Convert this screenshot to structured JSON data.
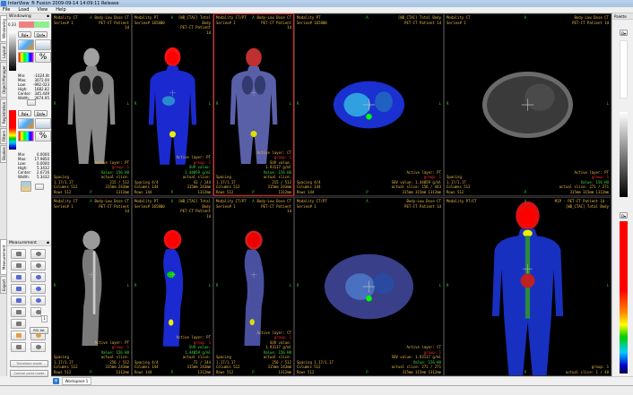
{
  "app": {
    "title": "InterView ® Fusion 2009-09-14 14:09:11 Release"
  },
  "menu": [
    "File",
    "Load",
    "View",
    "Help"
  ],
  "left_tabs": {
    "top": [
      "Windowing",
      "Layout",
      "Object Manager",
      "Registration",
      "Filters",
      "Studies"
    ],
    "bottom": [
      "Measurement",
      "Export"
    ]
  },
  "windowing": {
    "title": "Windowing",
    "opacity": "0.33",
    "layer1": {
      "pal": "Pal",
      "def": "Def",
      "min": "-1024.0t",
      "max": "3072.00",
      "low": "-992.023",
      "high": "1682.82",
      "center": "345.449",
      "width": "2674.95"
    },
    "layer2": {
      "pal": "Pal",
      "def": "Def",
      "min": "0.0000",
      "max": "17.9850",
      "low": "0.0000",
      "high": "5.3432",
      "center": "2.6716",
      "width": "5.3432"
    },
    "labels": {
      "min": "Min:",
      "max": "Max:",
      "low": "Low:",
      "high": "High:",
      "center": "Center:",
      "width": "Width:"
    }
  },
  "measurement": {
    "title": "Measurement",
    "spin_value": "1",
    "roi_button": "ROI list",
    "transform_button": "Transform mode",
    "control_point_button": "Control point mode"
  },
  "palette": {
    "title": "Palette",
    "dropdown": "D"
  },
  "taskbar": {
    "workspace_tab": "Workspace 1"
  },
  "colors": {
    "accent_selected": "#e22222",
    "overlay_text": "#e8b84a",
    "overlay_red": "#ff3030",
    "overlay_green": "#40e040"
  },
  "viewports": [
    {
      "img": "ct_cor",
      "tl": [
        "Modality CT",
        "Series# 1"
      ],
      "tr": [
        "Body-Low Dose CT",
        "PET-CT Patient",
        "1d"
      ],
      "bl": [
        "",
        "",
        "Spacing",
        "1.17/1.17",
        "Columns 512",
        "Rows 512"
      ],
      "br": [
        "Active layer: PT",
        "<r>group: 1",
        "<g>Value: 156 HU",
        "actual slice:",
        "215 / 512",
        "315mm 243mm",
        "1312mm"
      ]
    },
    {
      "img": "pet_cor",
      "tl": [
        "Modality PT",
        "Series# 165800"
      ],
      "tr": [
        "[WB_CTAC] Total",
        "Body",
        "PET-CT Patient",
        "1d"
      ],
      "bl": [
        "",
        "",
        "",
        "Spacing 4/4",
        "Columns 144",
        "Rows 144"
      ],
      "br": [
        "Active layer: PT",
        "<r>group: 1",
        "<g>SUV value:",
        "<g>1.44059 g/ml",
        "actual slice:",
        "43 / 144",
        "315mm 243mm",
        "1312mm"
      ]
    },
    {
      "img": "fus_cor",
      "sel": true,
      "tl": [
        "Modality CT/PT",
        "Series# 1"
      ],
      "tr": [
        "Body-Low Dose CT",
        "PET-CT Patient",
        "1d"
      ],
      "bl": [
        "",
        "",
        "Spacing",
        "1.17/1.17",
        "Columns 512",
        "Rows 512"
      ],
      "br": [
        "Active layer: CT",
        "<r>group: 1",
        "SUV value:",
        "1.93117 g/ml",
        "<g>Value: 156 HU",
        "actual slice:",
        "215 / 512",
        "315mm 243mm",
        "1312mm"
      ]
    },
    {
      "img": "pet_ax",
      "tl": [
        "Modality PT",
        "Series# 165800"
      ],
      "tr": [
        "[WB_CTAC] Total Body",
        "PET-CT Patient 1d"
      ],
      "bl": [
        "",
        "",
        "Spacing 4/4",
        "Columns 144",
        "Rows 144"
      ],
      "br": [
        "Active layer: PT",
        "<r>group: 1",
        "SUV value: 1.44059 g/ml",
        "actual slice: 156 / 443",
        "315mm 315mm 1312mm"
      ]
    },
    {
      "img": "ct_ax",
      "tl": [
        "Modality CT",
        "Series# 1"
      ],
      "tr": [
        "Body-Low Dose CT",
        "PET-CT Patient 1d"
      ],
      "bl": [
        "",
        "",
        "Spacing",
        "1.17/1.17",
        "Columns 512",
        "Rows 512"
      ],
      "br": [
        "Active layer: PT",
        "<r>group: 1",
        "<g>Value: 156 HU",
        "actual slice: 271 / 271",
        "315mm 315mm 1312mm"
      ]
    },
    {
      "img": "ct_sag",
      "tl": [
        "Modality CT",
        "Series# 1"
      ],
      "tr": [
        "Body-Low Dose CT",
        "PET-CT Patient",
        "1d"
      ],
      "bl": [
        "",
        "",
        "Spacing",
        "1.17/1.17",
        "Columns 512",
        "Rows 512"
      ],
      "br": [
        "Active layer: PT",
        "<r>group: 1",
        "<g>Value: 156 HU",
        "actual slice:",
        "256 / 512",
        "315mm 243mm",
        "1312mm"
      ]
    },
    {
      "img": "pet_sag",
      "tl": [
        "Modality PT",
        "Series# 165800"
      ],
      "tr": [
        "[WB_CTAC] Total",
        "Body",
        "PET-CT Patient",
        "1d"
      ],
      "bl": [
        "",
        "",
        "",
        "Spacing 4/4",
        "Columns 144",
        "Rows 144"
      ],
      "br": [
        "Active layer: PT",
        "<r>group: 1",
        "<g>SUV value:",
        "<g>1.44059 g/ml",
        "actual slice:",
        "72 / 144",
        "315mm 243mm",
        "1312mm"
      ]
    },
    {
      "img": "fus_sag",
      "tl": [
        "Modality CT/PT",
        "Series# 1"
      ],
      "tr": [
        "Body-Low Dose CT",
        "PET-CT Patient",
        "1d"
      ],
      "bl": [
        "",
        "",
        "Spacing",
        "1.17/1.17",
        "Columns 512",
        "Rows 512"
      ],
      "br": [
        "Active layer: CT",
        "<r>group: 1",
        "SUV value:",
        "1.93117 g/ml",
        "<g>Value: 156 HU",
        "actual slice:",
        "256 / 512",
        "315mm 243mm",
        "1312mm"
      ]
    },
    {
      "img": "fus_ax",
      "tl": [
        "Modality CT/PT",
        "Series# 1"
      ],
      "tr": [
        "Body-Low Dose CT",
        "PET-CT Patient 1d"
      ],
      "bl": [
        "",
        "",
        "Spacing 1.17/1.17",
        "Columns 512",
        "Rows 512"
      ],
      "br": [
        "Active layer: CT",
        "<r>group: 1",
        "SUV value: 1.93117 g/ml",
        "<g>Value: 156 HU",
        "actual slice: 271 / 271",
        "315mm 315mm 1312mm"
      ]
    },
    {
      "img": "mip",
      "tl": [
        "Modality PT/CT"
      ],
      "tr": [
        "MIP - PET-CT Patient 1d -",
        "[WB_CTAC] Total Body"
      ],
      "bl": [],
      "br": [
        "group: 1",
        "actual slice: 1 / 48"
      ]
    }
  ]
}
